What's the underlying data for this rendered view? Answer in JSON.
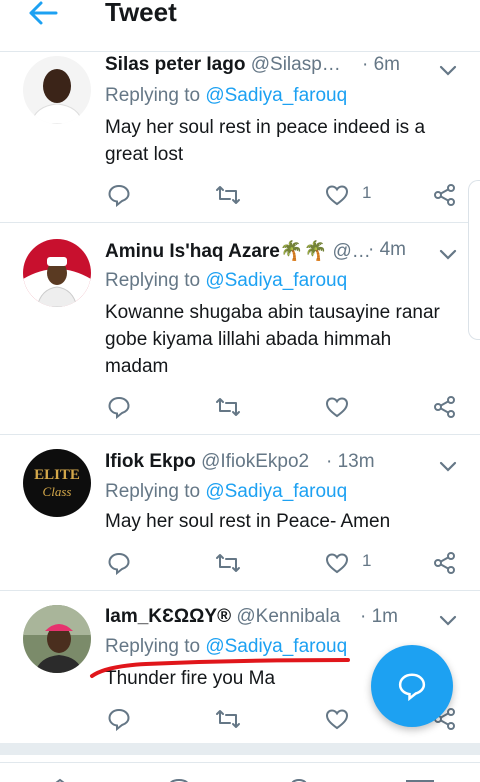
{
  "header": {
    "title": "Tweet"
  },
  "tweets": [
    {
      "name": "Silas peter Iago",
      "handle": "@Silasp…",
      "time": "· 6m",
      "replying_prefix": "Replying to ",
      "replying_to": "@Sadiya_farouq",
      "text": "May her soul rest in peace indeed is a great lost",
      "likes": "1"
    },
    {
      "name": "Aminu Is'haq Azare🌴🌴",
      "handle": "@…",
      "time": "· 4m",
      "replying_prefix": "Replying to ",
      "replying_to": "@Sadiya_farouq",
      "text": "Kowanne shugaba abin tausayine ranar gobe kiyama lillahi abada himmah madam",
      "likes": ""
    },
    {
      "name": "Ifiok Ekpo",
      "handle": "@IfiokEkpo2",
      "time": "· 13m",
      "replying_prefix": "Replying to ",
      "replying_to": "@Sadiya_farouq",
      "text": "May her soul rest in Peace- Amen",
      "likes": "1",
      "avatar_text_1": "ELITE",
      "avatar_text_2": "Class"
    },
    {
      "name": "Iam_KƐΩΩY®",
      "handle": "@Kennibala",
      "time": "· 1m",
      "replying_prefix": "Replying to ",
      "replying_to": "@Sadiya_farouq",
      "text": "Thunder fire you Ma",
      "likes": ""
    }
  ],
  "colors": {
    "accent": "#1da1f2",
    "muted": "#657786",
    "text": "#14171a",
    "annotation": "#e0161b"
  },
  "icons": [
    "back-arrow-icon",
    "chevron-down-icon",
    "reply-icon",
    "retweet-icon",
    "like-icon",
    "share-icon",
    "compose-reply-icon"
  ]
}
